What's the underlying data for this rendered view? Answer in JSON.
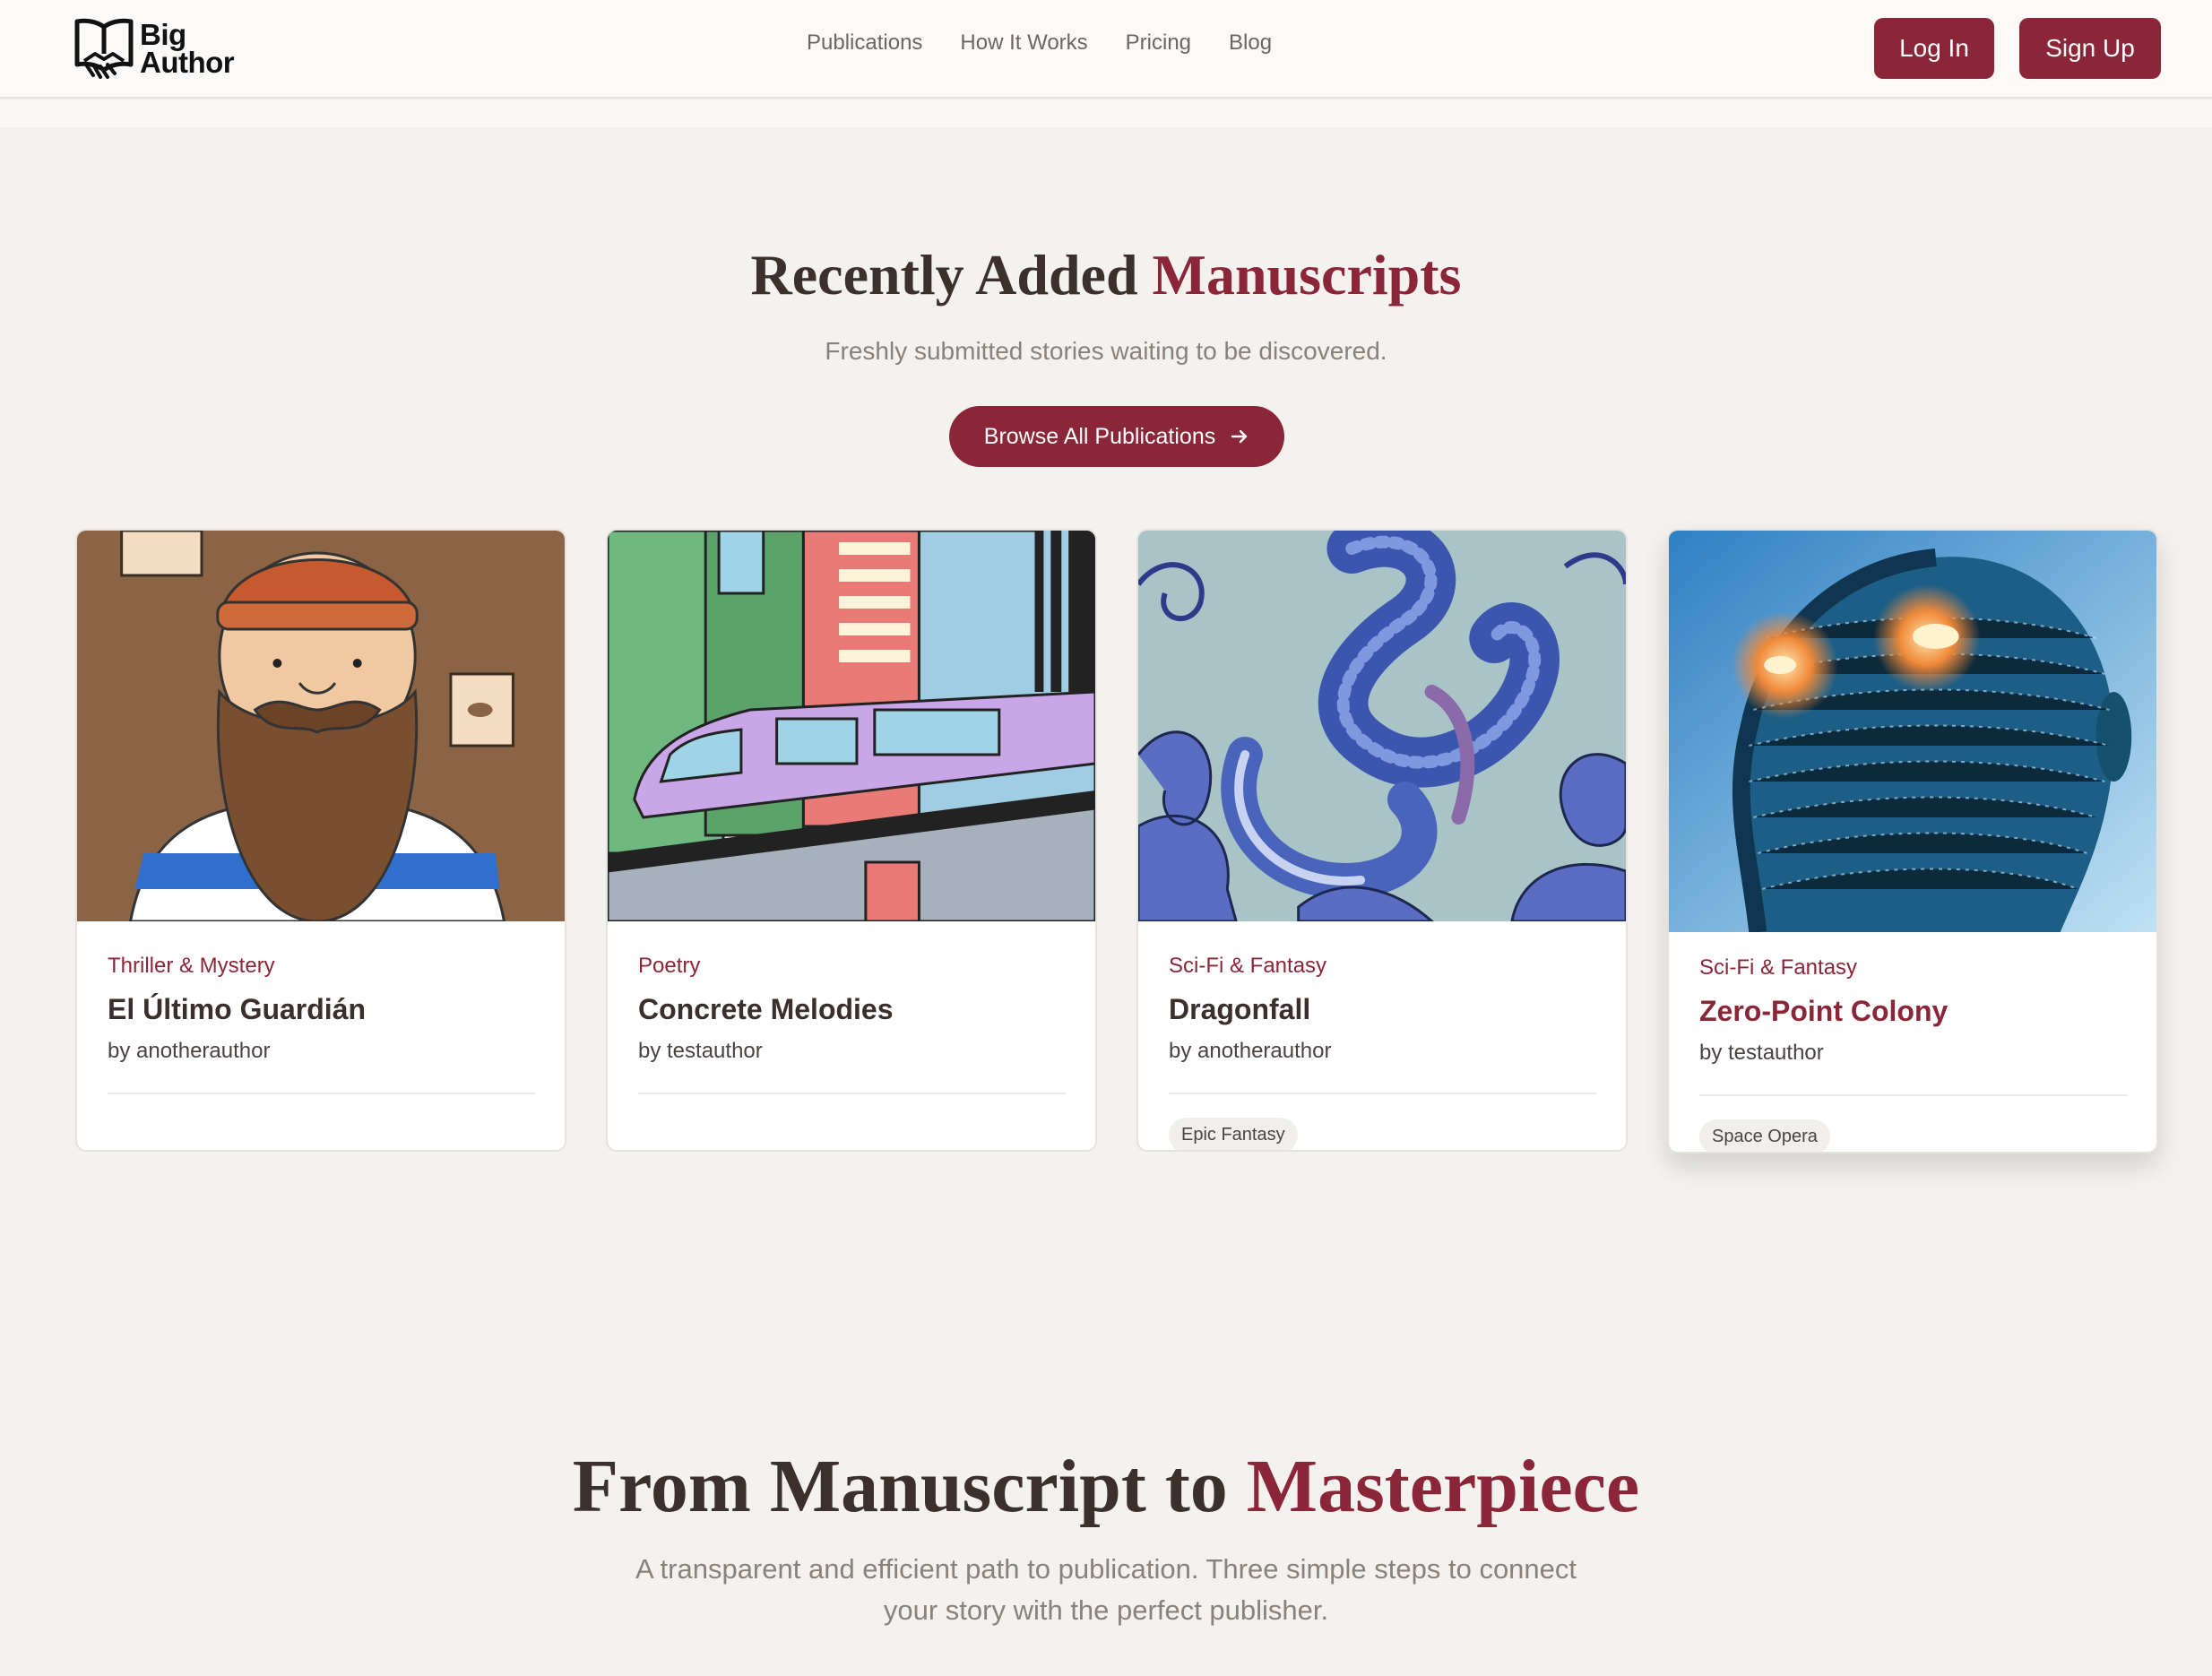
{
  "brand": {
    "name_line1": "Big",
    "name_line2": "Author",
    "accent": "#8a2637"
  },
  "nav": [
    {
      "label": "Publications"
    },
    {
      "label": "How It Works"
    },
    {
      "label": "Pricing"
    },
    {
      "label": "Blog"
    }
  ],
  "auth": {
    "login": "Log In",
    "signup": "Sign Up"
  },
  "recent": {
    "title_plain": "Recently Added",
    "title_accent": "Manuscripts",
    "subtitle": "Freshly submitted stories waiting to be discovered.",
    "browse_label": "Browse All Publications"
  },
  "cards": [
    {
      "genre": "Thriller & Mystery",
      "title": "El Último Guardián",
      "author": "by anotherauthor",
      "tag": ""
    },
    {
      "genre": "Poetry",
      "title": "Concrete Melodies",
      "author": "by testauthor",
      "tag": ""
    },
    {
      "genre": "Sci-Fi & Fantasy",
      "title": "Dragonfall",
      "author": "by anotherauthor",
      "tag": "Epic Fantasy"
    },
    {
      "genre": "Sci-Fi & Fantasy",
      "title": "Zero-Point Colony",
      "author": "by testauthor",
      "tag": "Space Opera"
    }
  ],
  "how": {
    "title_plain": "From Manuscript to",
    "title_accent": "Masterpiece",
    "subtitle_line1": "A transparent and efficient path to publication. Three simple steps to connect",
    "subtitle_line2": "your story with the perfect publisher."
  },
  "icons": [
    "book-handshake-icon",
    "arrow-right-icon"
  ]
}
